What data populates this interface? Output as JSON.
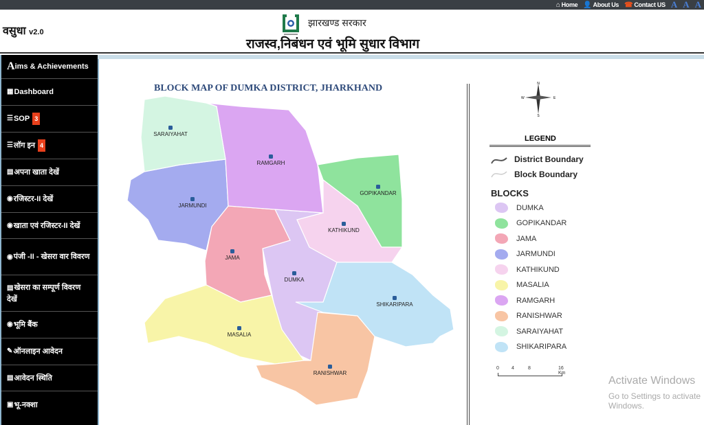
{
  "topbar": {
    "links": [
      "Home",
      "About Us",
      "Contact US"
    ],
    "font_sizes": [
      "A",
      "A",
      "A"
    ]
  },
  "header": {
    "brand": "वसुधा",
    "version": "v2.0",
    "gov": "झारखण्ड सरकार",
    "department": "राजस्व,निबंधन एवं भूमि सुधार  विभाग"
  },
  "sidebar": {
    "items": [
      {
        "label": "ims & Achievements",
        "prefix": "A"
      },
      {
        "label": "Dashboard"
      },
      {
        "label": "SOP",
        "badge": "3"
      },
      {
        "label": "लॉग इन",
        "badge": "4"
      },
      {
        "label": "अपना खाता देखें"
      },
      {
        "label": "रजिस्टर-II देखें"
      },
      {
        "label": "खाता एवं रजिस्टर-II देखें"
      },
      {
        "label": "पंजी -II - खेसरा वार विवरण"
      },
      {
        "label": "खेसरा का सम्पूर्ण विवरण देखें"
      },
      {
        "label": "भूमि बैंक"
      },
      {
        "label": "ऑनलाइन आवेदन"
      },
      {
        "label": "आवेदन स्थिति"
      },
      {
        "label": "भू-नक्शा"
      }
    ]
  },
  "map": {
    "title": "BLOCK MAP OF DUMKA DISTRICT, JHARKHAND",
    "legend_title": "LEGEND",
    "district_boundary": "District Boundary",
    "block_boundary": "Block Boundary",
    "blocks_heading": "BLOCKS",
    "blocks": [
      {
        "name": "DUMKA",
        "color": "#dcc6f3"
      },
      {
        "name": "GOPIKANDAR",
        "color": "#8fe39d"
      },
      {
        "name": "JAMA",
        "color": "#f3a7b6"
      },
      {
        "name": "JARMUNDI",
        "color": "#a4abef"
      },
      {
        "name": "KATHIKUND",
        "color": "#f6d3ee"
      },
      {
        "name": "MASALIA",
        "color": "#f8f4a8"
      },
      {
        "name": "RAMGARH",
        "color": "#dba6f2"
      },
      {
        "name": "RANISHWAR",
        "color": "#f8c5a4"
      },
      {
        "name": "SARAIYAHAT",
        "color": "#d4f5e2"
      },
      {
        "name": "SHIKARIPARA",
        "color": "#c0e3f6"
      }
    ],
    "scale": [
      "0",
      "4",
      "8",
      "16 Km"
    ],
    "compass": [
      "N",
      "S",
      "E",
      "W"
    ]
  },
  "watermark": {
    "line1": "Activate Windows",
    "line2": "Go to Settings to activate Windows."
  }
}
